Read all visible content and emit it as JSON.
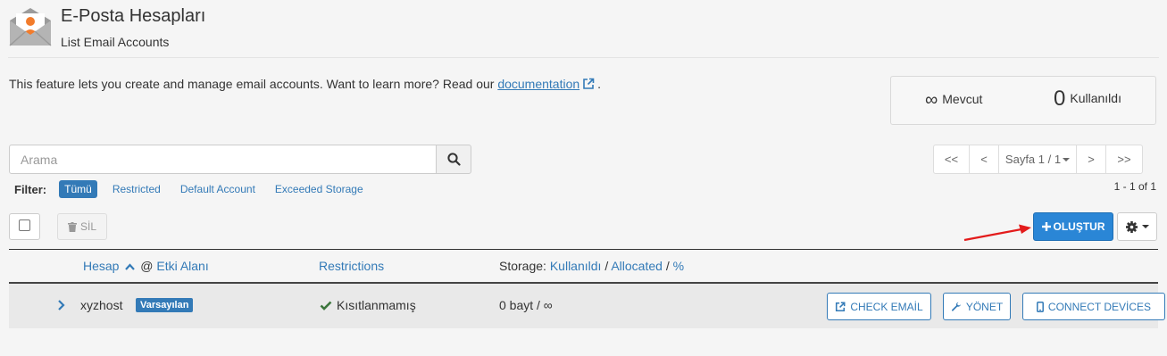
{
  "header": {
    "title": "E-Posta Hesapları",
    "subtitle": "List Email Accounts"
  },
  "intro": {
    "text": "This feature lets you create and manage email accounts. Want to learn more? Read our ",
    "link": "documentation",
    "suffix": "."
  },
  "stats": {
    "available_value": "∞",
    "available_label": "Mevcut",
    "used_value": "0",
    "used_label": "Kullanıldı"
  },
  "search": {
    "placeholder": "Arama"
  },
  "pagination": {
    "first": "<<",
    "prev": "<",
    "page": "Sayfa 1 / 1",
    "next": ">",
    "last": ">>",
    "count": "1 - 1 of 1"
  },
  "filter": {
    "label": "Filter:",
    "options": [
      "Tümü",
      "Restricted",
      "Default Account",
      "Exceeded Storage"
    ],
    "active": "Tümü"
  },
  "toolbar": {
    "delete_label": "SİL",
    "create_label": "OLUŞTUR"
  },
  "table": {
    "col_account": "Hesap",
    "col_at": "@",
    "col_domain": "Etki Alanı",
    "col_restrictions": "Restrictions",
    "col_storage_prefix": "Storage:",
    "col_storage_used": "Kullanıldı",
    "col_storage_allocated": "Allocated",
    "col_storage_percent": "%",
    "sep": "/",
    "rows": [
      {
        "account": "xyzhost",
        "badge": "Varsayılan",
        "restriction": "Kısıtlanmamış",
        "storage": "0 bayt / ∞",
        "check_email": "CHECK EMAİL",
        "manage": "YÖNET",
        "connect": "CONNECT DEVİCES"
      }
    ]
  },
  "colors": {
    "accent": "#337ab7",
    "primary_button": "#2a86d6",
    "success_check": "#3c763d",
    "annotation_arrow": "#e31b1b"
  }
}
